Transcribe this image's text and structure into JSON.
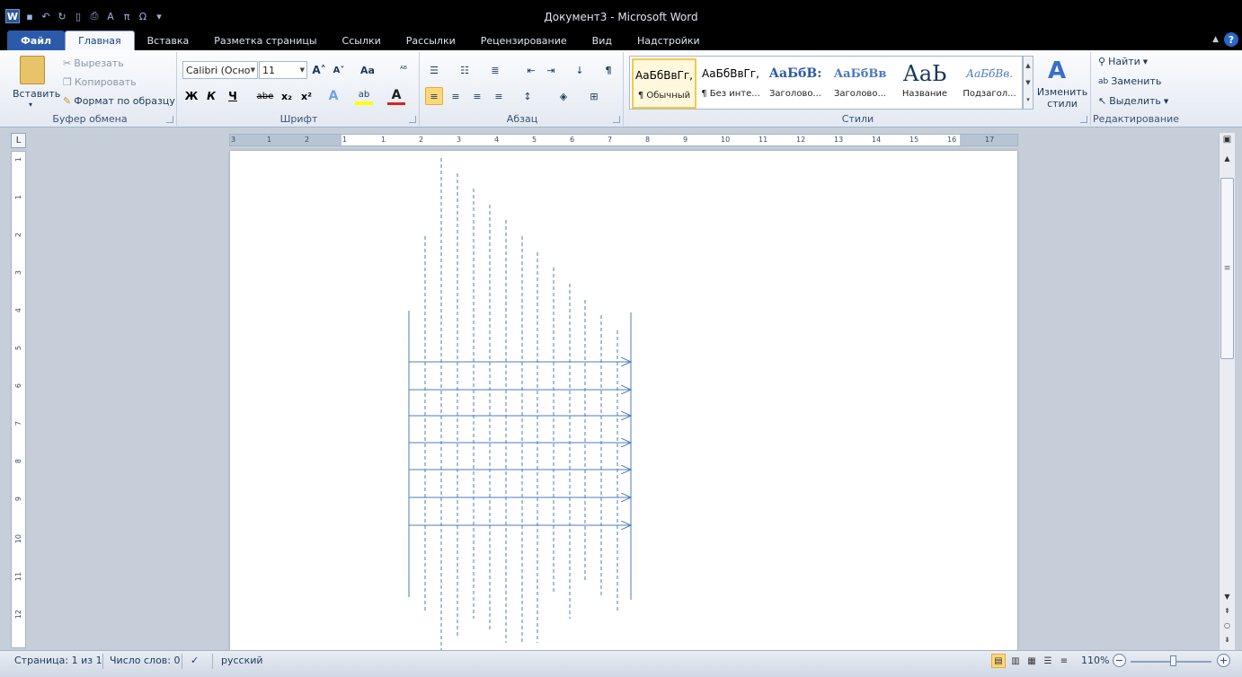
{
  "window": {
    "title": "Документ3 - Microsoft Word"
  },
  "qat": {
    "app_icon": "W"
  },
  "tabs": [
    {
      "label": "Файл"
    },
    {
      "label": "Главная"
    },
    {
      "label": "Вставка"
    },
    {
      "label": "Разметка страницы"
    },
    {
      "label": "Ссылки"
    },
    {
      "label": "Рассылки"
    },
    {
      "label": "Рецензирование"
    },
    {
      "label": "Вид"
    },
    {
      "label": "Надстройки"
    }
  ],
  "clipboard": {
    "paste": "Вставить",
    "cut": "Вырезать",
    "copy": "Копировать",
    "format_painter": "Формат по образцу",
    "label": "Буфер обмена"
  },
  "font": {
    "name": "Calibri (Осно",
    "size": "11",
    "label": "Шрифт",
    "bold": "Ж",
    "italic": "К",
    "underline": "Ч",
    "strike": "abe"
  },
  "paragraph": {
    "label": "Абзац"
  },
  "styles": {
    "label": "Стили",
    "items": [
      {
        "preview": "АаБбВвГг,",
        "name": "¶ Обычный"
      },
      {
        "preview": "АаБбВвГг,",
        "name": "¶ Без инте..."
      },
      {
        "preview": "АаБбВ:",
        "name": "Заголово..."
      },
      {
        "preview": "АаБбВв",
        "name": "Заголово..."
      },
      {
        "preview": "АаЬ",
        "name": "Название"
      },
      {
        "preview": "АаБбВв.",
        "name": "Подзагол..."
      }
    ],
    "change": "Изменить стили"
  },
  "editing": {
    "find": "Найти",
    "replace": "Заменить",
    "select": "Выделить",
    "label": "Редактирование"
  },
  "ruler": {
    "h": [
      "3",
      "1",
      "2",
      "1",
      "1",
      "2",
      "3",
      "4",
      "5",
      "6",
      "7",
      "8",
      "9",
      "10",
      "11",
      "12",
      "13",
      "14",
      "15",
      "16",
      "17"
    ],
    "v": [
      "1",
      "1",
      "2",
      "3",
      "4",
      "5",
      "6",
      "7",
      "8",
      "9",
      "10",
      "11",
      "12"
    ],
    "corner": "L"
  },
  "status": {
    "page": "Страница: 1 из 1",
    "words": "Число слов: 0",
    "lang": "русский",
    "zoom": "110%"
  },
  "colors": {
    "accent": "#2a5aa9",
    "line": "#4e7bbf"
  }
}
